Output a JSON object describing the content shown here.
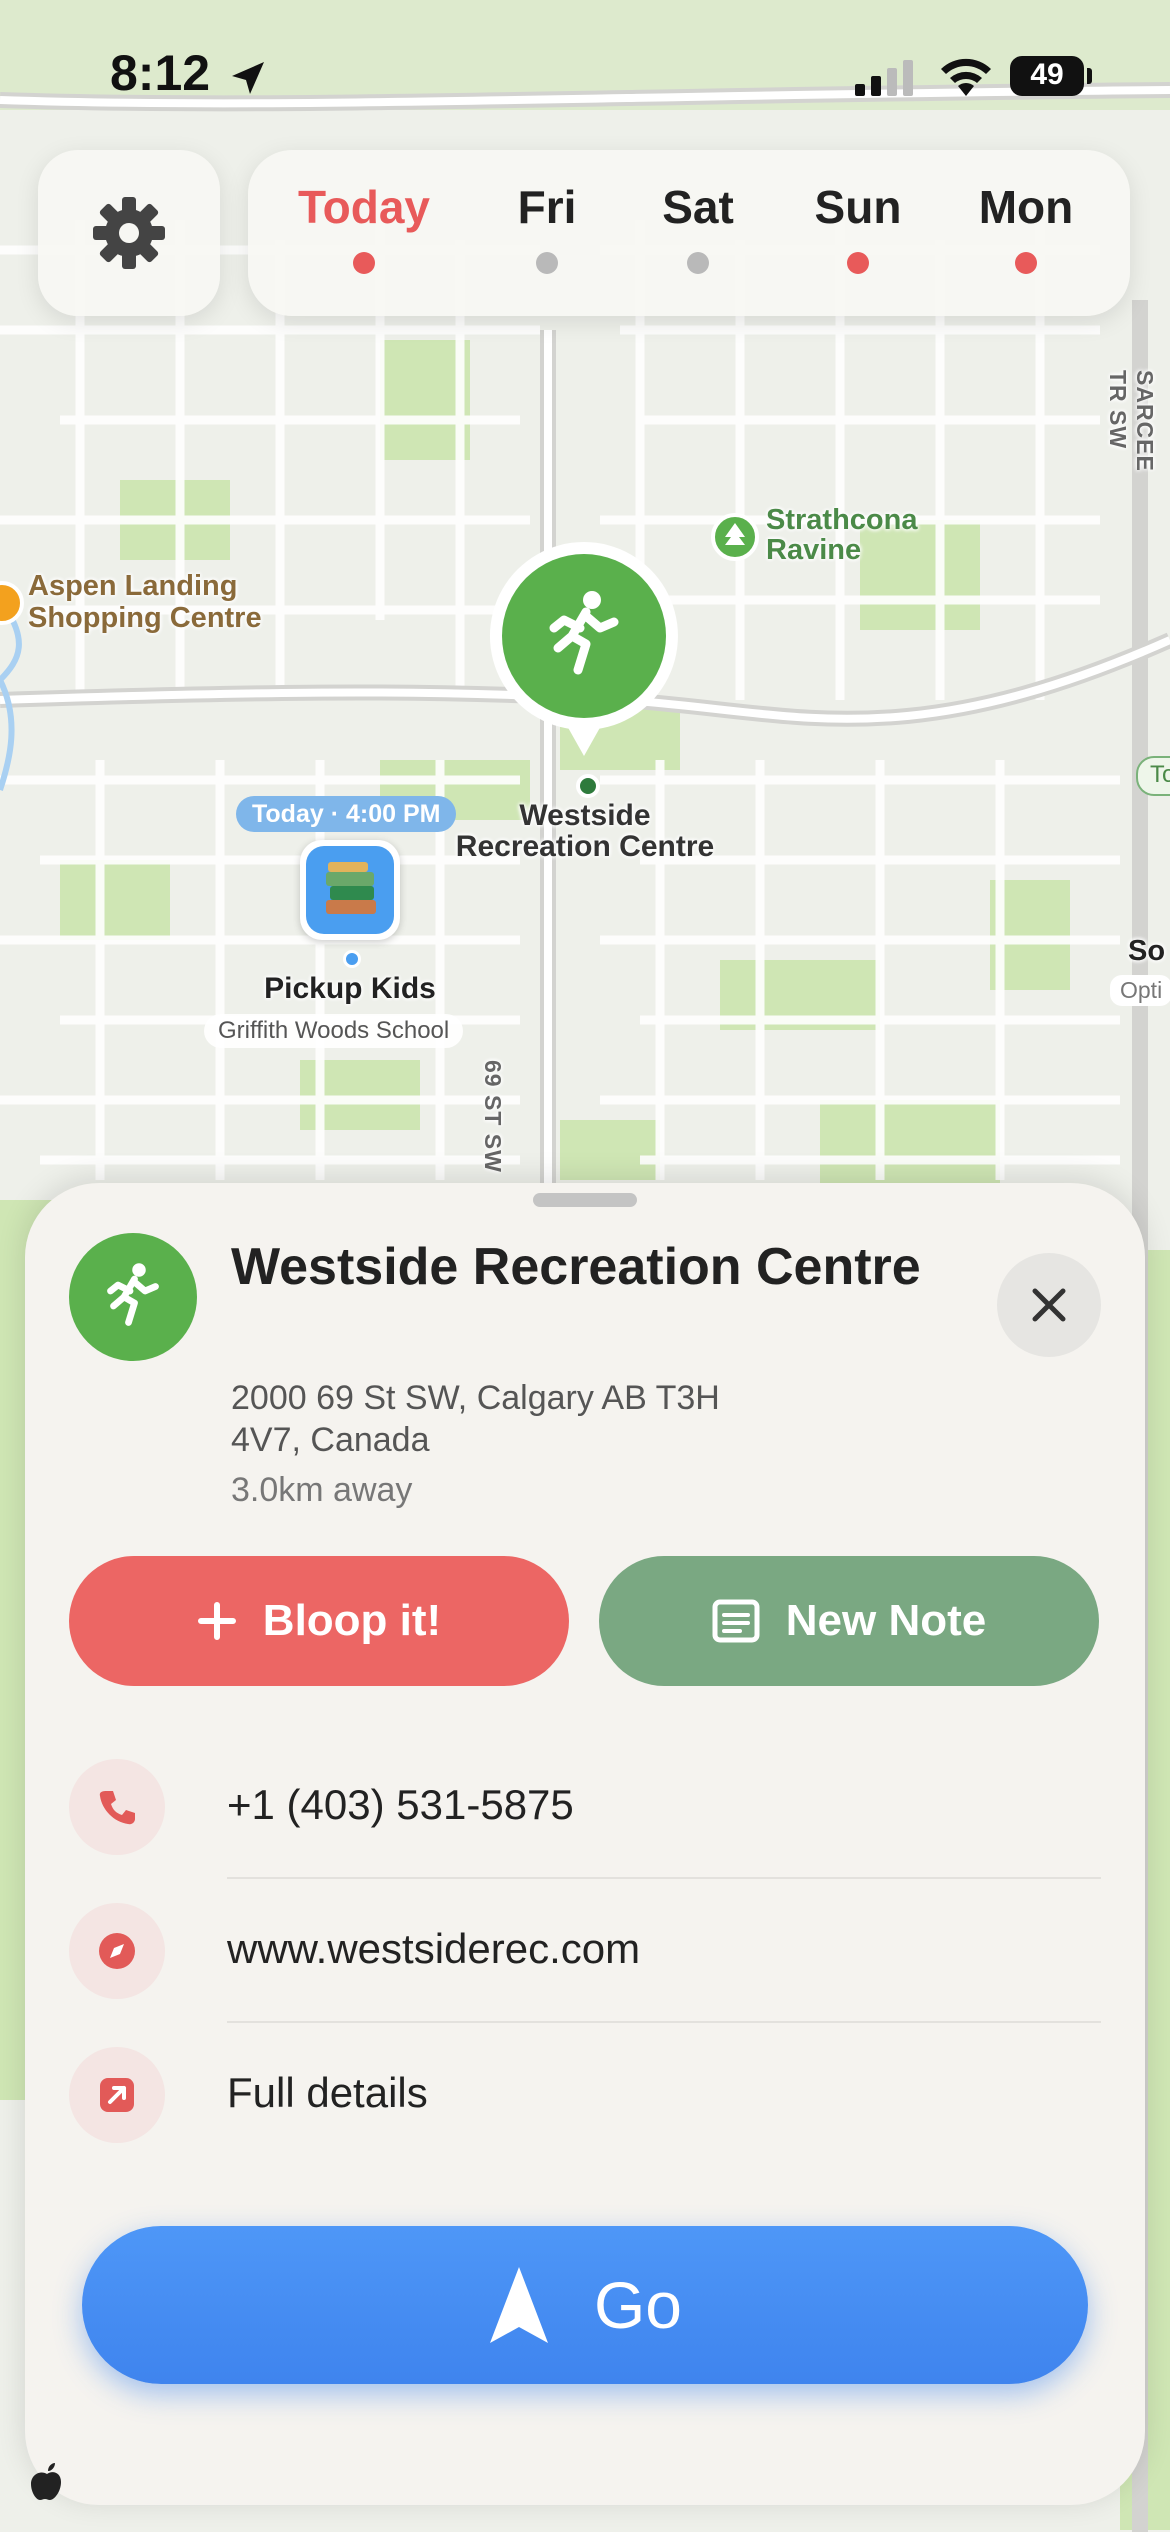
{
  "status_bar": {
    "time": "8:12",
    "battery": "49"
  },
  "day_tabs": [
    {
      "label": "Today",
      "dot_color": "#e85a5a",
      "active": true
    },
    {
      "label": "Fri",
      "dot_color": "#b9b9b9",
      "active": false
    },
    {
      "label": "Sat",
      "dot_color": "#b9b9b9",
      "active": false
    },
    {
      "label": "Sun",
      "dot_color": "#e85a5a",
      "active": false
    },
    {
      "label": "Mon",
      "dot_color": "#e85a5a",
      "active": false
    }
  ],
  "map": {
    "poi_strathcona": "Strathcona\nRavine",
    "poi_aspen": "Aspen Landing\nShopping Centre",
    "street_69": "69 ST SW",
    "street_sarcee": "SARCEE TR SW",
    "edge_to": "To",
    "edge_so": "So",
    "edge_opti": "Opti",
    "selected_pin_label": "Westside\nRecreation Centre",
    "reminder_badge": "Today · 4:00 PM",
    "reminder_title": "Pickup Kids",
    "reminder_subtitle": "Griffith Woods School"
  },
  "place": {
    "name": "Westside Recreation Centre",
    "address": "2000 69 St SW, Calgary AB T3H 4V7, Canada",
    "distance": "3.0km away"
  },
  "actions": {
    "bloop_label": "Bloop it!",
    "new_note_label": "New Note",
    "go_label": "Go"
  },
  "details": {
    "phone": "+1 (403) 531-5875",
    "website": "www.westsiderec.com",
    "full_details": "Full details"
  },
  "colors": {
    "accent_red": "#ec6664",
    "note_green": "#7aa882",
    "place_green": "#5ab04c",
    "go_blue": "#3f84ee"
  },
  "icons": {
    "settings": "gear-icon",
    "place": "running-person-icon",
    "phone": "phone-icon",
    "website": "compass-icon",
    "details": "arrow-up-right-icon",
    "go": "navigation-arrow-icon"
  }
}
